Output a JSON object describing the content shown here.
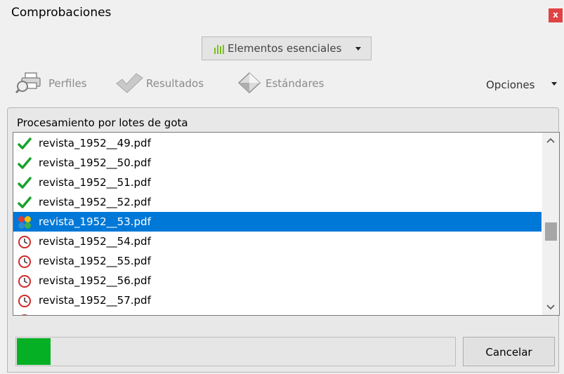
{
  "window": {
    "title": "Comprobaciones",
    "close_glyph": "x"
  },
  "profile_dropdown": {
    "label": "Elementos esenciales",
    "icon": "bars-icon",
    "icon_color": "#7cc018"
  },
  "toolbar": {
    "perfiles": "Perfiles",
    "resultados": "Resultados",
    "estandares": "Estándares",
    "opciones": "Opciones"
  },
  "panel": {
    "title": "Procesamiento por lotes de gota",
    "files": [
      {
        "name": "revista_1952__49.pdf",
        "status": "done"
      },
      {
        "name": "revista_1952__50.pdf",
        "status": "done"
      },
      {
        "name": "revista_1952__51.pdf",
        "status": "done"
      },
      {
        "name": "revista_1952__52.pdf",
        "status": "done"
      },
      {
        "name": "revista_1952__53.pdf",
        "status": "processing",
        "selected": true
      },
      {
        "name": "revista_1952__54.pdf",
        "status": "pending"
      },
      {
        "name": "revista_1952__55.pdf",
        "status": "pending"
      },
      {
        "name": "revista_1952__56.pdf",
        "status": "pending"
      },
      {
        "name": "revista_1952__57.pdf",
        "status": "pending"
      }
    ]
  },
  "progress": {
    "fraction": 0.077,
    "color": "#06b025"
  },
  "cancel_label": "Cancelar",
  "colors": {
    "selection": "#0078d7",
    "check": "#17a22b",
    "close": "#e04343"
  }
}
